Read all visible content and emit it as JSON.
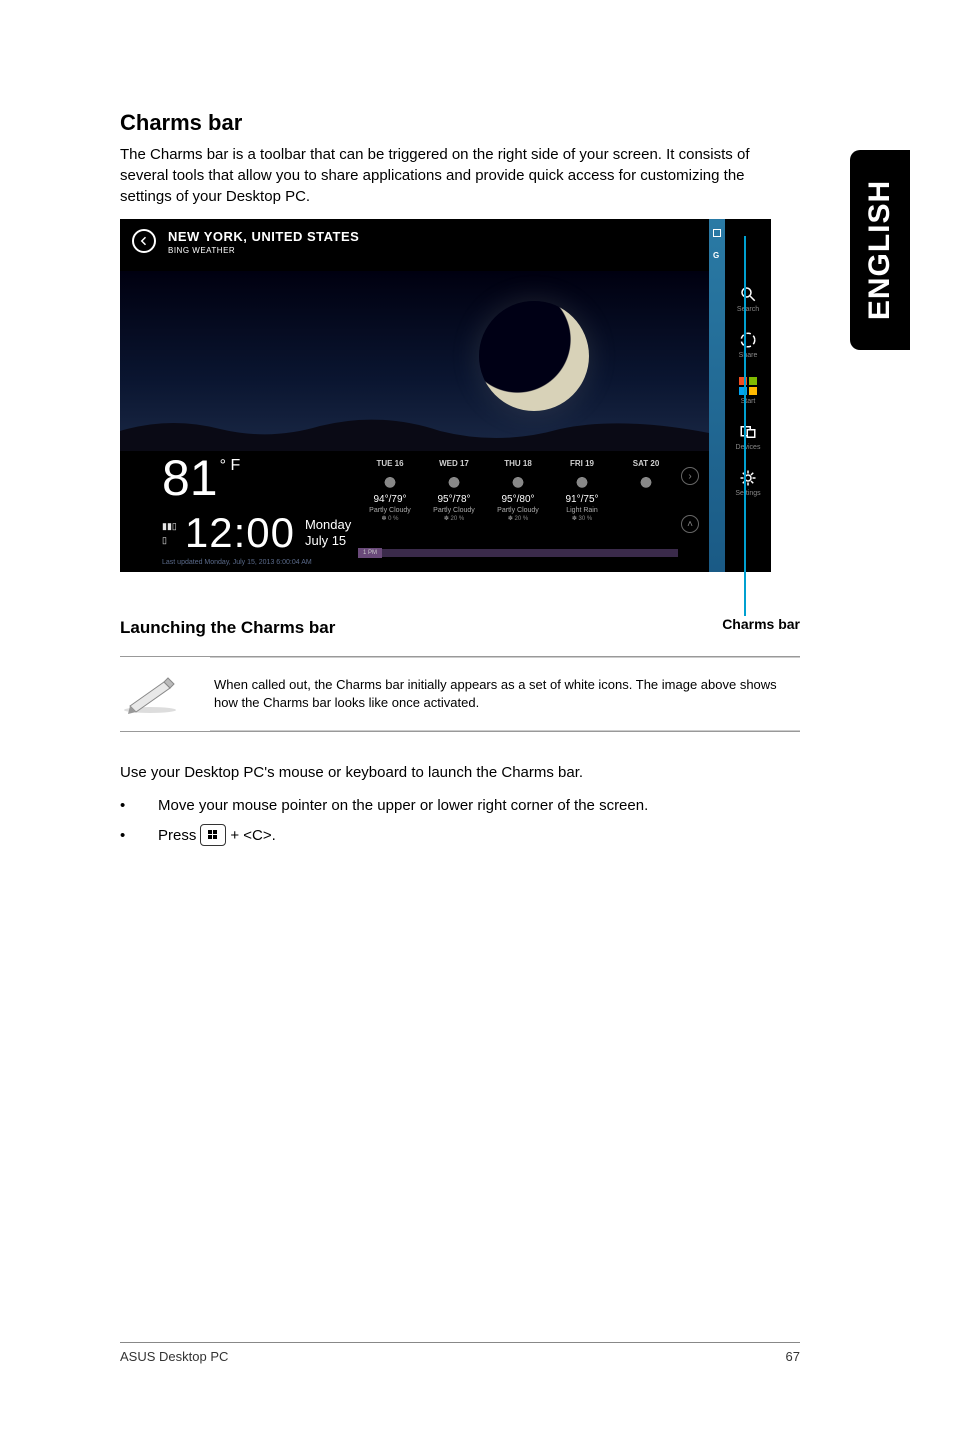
{
  "sideTab": "ENGLISH",
  "heading": "Charms bar",
  "intro": "The Charms bar is a toolbar that can be triggered on the right side of your screen. It consists of several tools that allow you to share applications and provide quick access for customizing the settings of your Desktop PC.",
  "screenshot": {
    "location": "NEW YORK, UNITED STATES",
    "appName": "BING WEATHER",
    "currentTemp": "81",
    "tempUnit": "° F",
    "clockTime": "12:00",
    "dayName": "Monday",
    "dateStr": "July 15",
    "lastUpdated": "Last updated Monday, July 15, 2013 6:00:04 AM",
    "hourMark": "1 PM",
    "peekLetter": "G",
    "forecast": [
      {
        "day": "TUE 16",
        "hilo": "94°/79°",
        "cond": "Partly Cloudy",
        "prec": "✽ 0 %"
      },
      {
        "day": "WED 17",
        "hilo": "95°/78°",
        "cond": "Partly Cloudy",
        "prec": "✽ 20 %"
      },
      {
        "day": "THU 18",
        "hilo": "95°/80°",
        "cond": "Partly Cloudy",
        "prec": "✽ 20 %"
      },
      {
        "day": "FRI 19",
        "hilo": "91°/75°",
        "cond": "Light Rain",
        "prec": "✽ 30 %"
      },
      {
        "day": "SAT 20",
        "hilo": "",
        "cond": "",
        "prec": ""
      }
    ],
    "charms": [
      {
        "name": "search",
        "label": "Search"
      },
      {
        "name": "share",
        "label": "Share"
      },
      {
        "name": "start",
        "label": "Start"
      },
      {
        "name": "devices",
        "label": "Devices"
      },
      {
        "name": "settings",
        "label": "Settings"
      }
    ]
  },
  "calloutLabel": "Charms bar",
  "subheading": "Launching the Charms bar",
  "noteText": "When called out, the Charms bar initially appears as a set of white icons. The image above shows how the Charms bar looks like once activated.",
  "stepsIntro": "Use your Desktop PC's mouse or keyboard to launch the Charms bar.",
  "step1": "Move your mouse pointer on the upper or lower right corner of the screen.",
  "step2a": "Press ",
  "step2b": " + <C>.",
  "footerLeft": "ASUS Desktop PC",
  "footerRight": "67"
}
